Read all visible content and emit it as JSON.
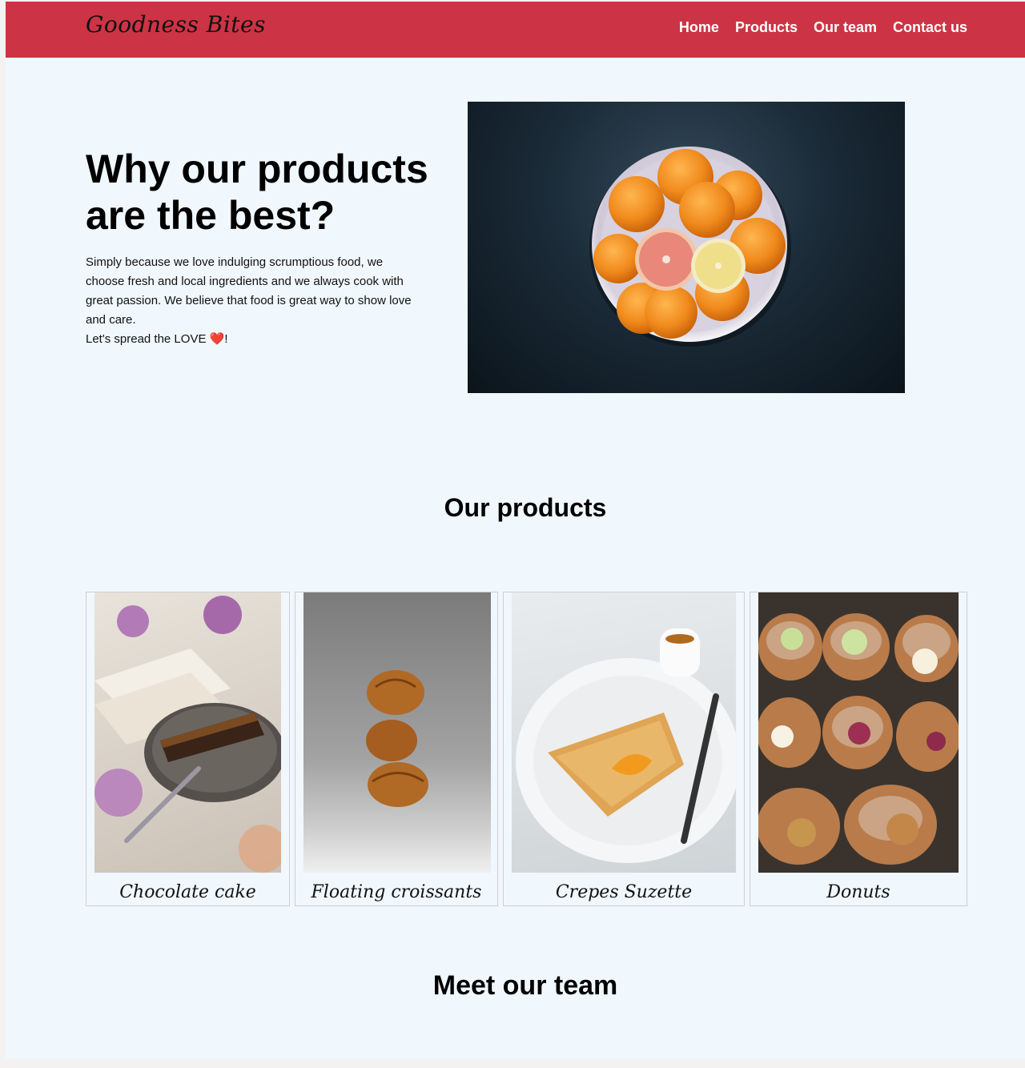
{
  "navbar": {
    "logo": "Goodness Bites",
    "links": [
      {
        "label": "Home"
      },
      {
        "label": "Products"
      },
      {
        "label": "Our team"
      },
      {
        "label": "Contact us"
      }
    ]
  },
  "hero": {
    "title": "Why our products are the best?",
    "text": "Simply because we love indulging scrumptious food, we choose fresh and local ingredients and we always cook with great passion. We believe that food is great way to show love and care.",
    "love_prefix": "Let's spread the LOVE ",
    "heart": "❤️",
    "love_suffix": "!"
  },
  "products": {
    "title": "Our products",
    "items": [
      {
        "name": "Chocolate cake"
      },
      {
        "name": "Floating croissants"
      },
      {
        "name": "Crepes Suzette"
      },
      {
        "name": "Donuts"
      }
    ]
  },
  "team": {
    "title": "Meet our team"
  },
  "colors": {
    "navbar": "#cc3344",
    "page_background": "#f0f7fd"
  }
}
